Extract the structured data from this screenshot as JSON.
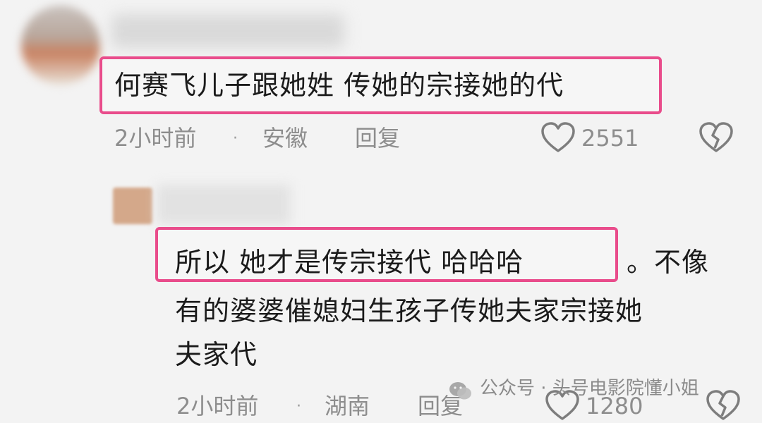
{
  "comment1": {
    "text": "何赛飞儿子跟她姓 传她的宗接她的代",
    "time": "2小时前",
    "separator": "·",
    "location": "安徽",
    "reply_label": "回复",
    "likes": "2551"
  },
  "comment2": {
    "text_highlighted": "所以 她才是传宗接代 哈哈哈",
    "text_line1_rest": "。不像",
    "text_line2": "有的婆婆催媳妇生孩子传她夫家宗接她",
    "text_line3": "夫家代",
    "time": "2小时前",
    "separator": "·",
    "location": "湖南",
    "reply_label": "回复",
    "likes": "1280"
  },
  "watermark": {
    "text": "公众号 · 头号电影院懂小姐"
  },
  "colors": {
    "highlight_border": "#e94c8b",
    "meta_text": "#8d8d8d",
    "background": "#f3f3f3"
  },
  "icons": [
    "heart-icon",
    "broken-heart-icon",
    "wechat-icon"
  ]
}
